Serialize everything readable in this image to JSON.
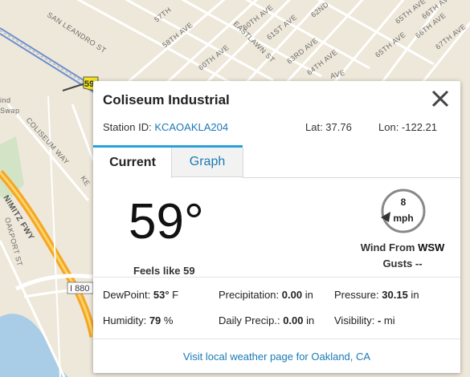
{
  "map": {
    "streets": [
      "57TH",
      "SAN LEANDRO ST",
      "58TH AVE",
      "60TH AVE",
      "60TH AVE",
      "EASTLAWN ST",
      "61ST AVE",
      "62ND",
      "65TH AVE",
      "66TH AVE",
      "65TH AVE",
      "66TH AVE",
      "67TH AVE",
      "63RD AVE",
      "64TH AVE",
      "AVE",
      "COLISEUM WAY",
      "NIMITZ FWY",
      "OAKPORT ST",
      "KE"
    ],
    "highway": "I 880",
    "marker_value": "59",
    "area_label_1": "ind",
    "area_label_2": "Swap"
  },
  "popup": {
    "title": "Coliseum Industrial",
    "station_label": "Station ID:",
    "station_id": "KCAOAKLA204",
    "lat": "Lat: 37.76",
    "lon": "Lon: -122.21",
    "tabs": [
      "Current",
      "Graph"
    ],
    "temperature": "59°",
    "feels_like": "Feels like 59",
    "wind": {
      "speed": "8",
      "unit": "mph",
      "from_label": "Wind From",
      "direction": "WSW",
      "gusts": "Gusts --"
    },
    "obs": {
      "dewpoint_label": "DewPoint:",
      "dewpoint_value": "53°",
      "dewpoint_unit": " F",
      "precip_label": "Precipitation:",
      "precip_value": "0.00",
      "precip_unit": " in",
      "pressure_label": "Pressure:",
      "pressure_value": "30.15",
      "pressure_unit": " in",
      "humidity_label": "Humidity:",
      "humidity_value": "79",
      "humidity_unit": " %",
      "daily_label": "Daily Precip.:",
      "daily_value": "0.00",
      "daily_unit": " in",
      "visibility_label": "Visibility:",
      "visibility_value": "-",
      "visibility_unit": " mi"
    },
    "visit_link": "Visit local weather page for Oakland, CA"
  },
  "colors": {
    "link": "#1a7ab5",
    "tab_accent": "#2a9fd8",
    "freeway": "#f5a623",
    "marker": "#f4e41c"
  }
}
